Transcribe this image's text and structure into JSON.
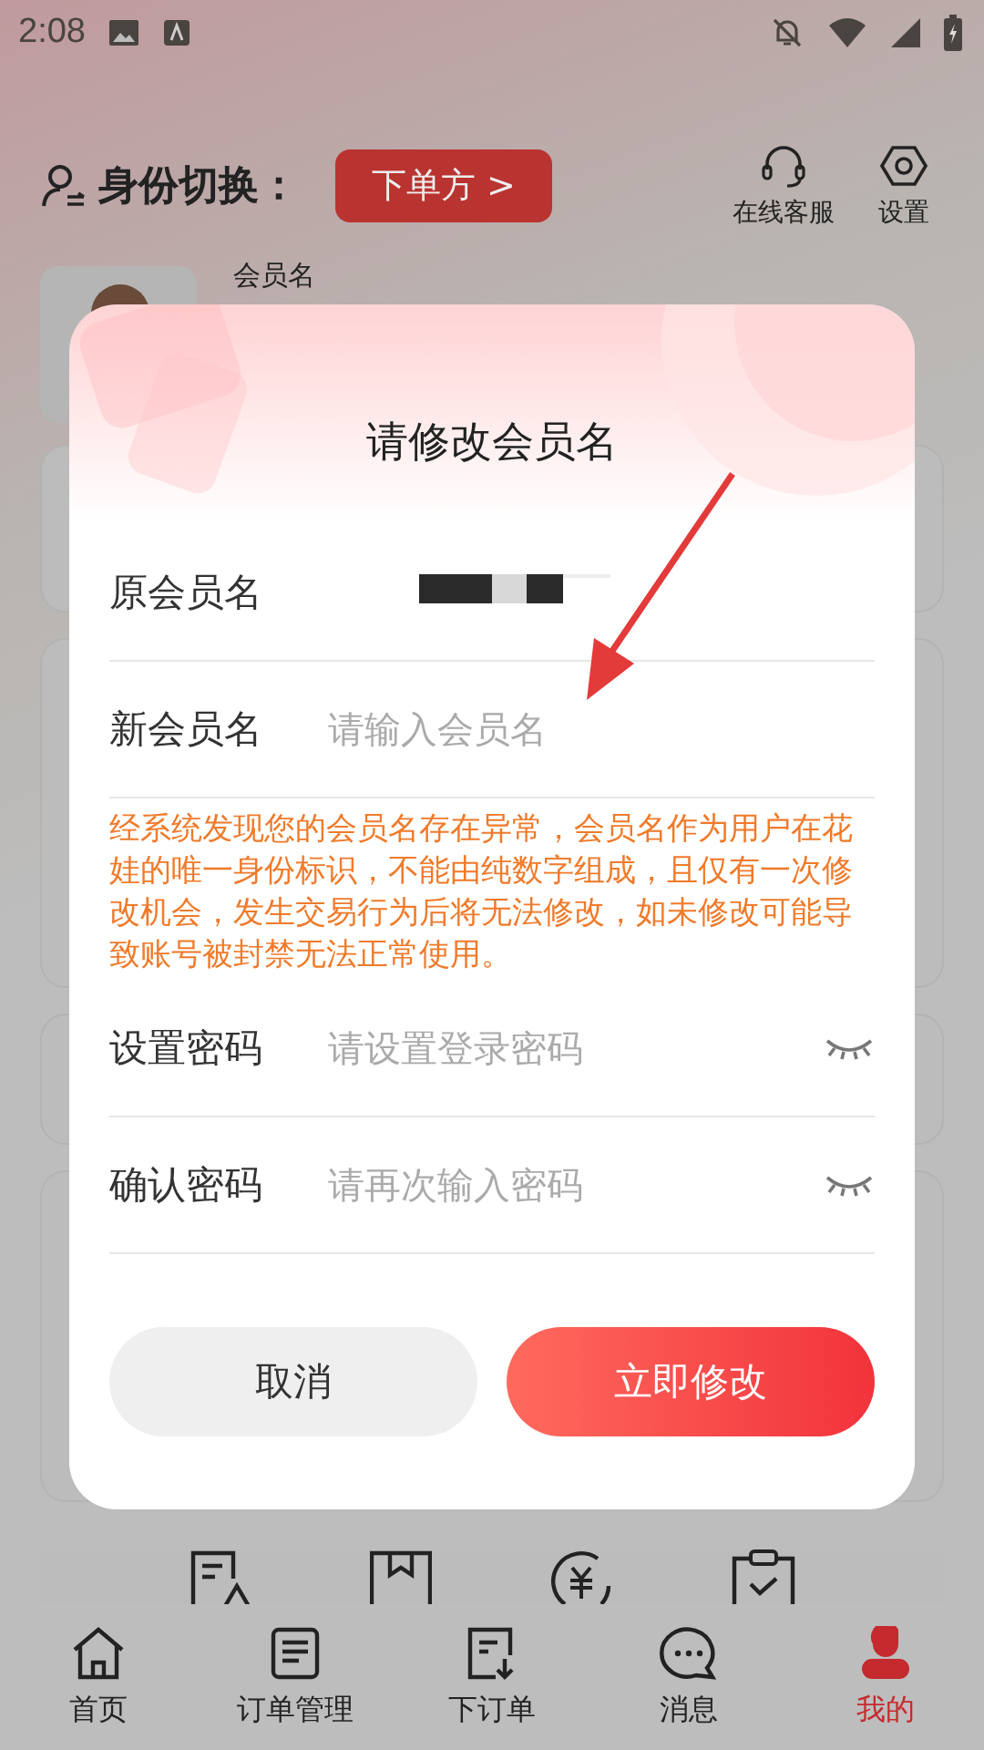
{
  "status_bar": {
    "time": "2:08"
  },
  "header": {
    "switch_label": "身份切换：",
    "role_button": "下单方 >",
    "actions": [
      {
        "kind": "headset",
        "label": "在线客服"
      },
      {
        "kind": "settings",
        "label": "设置"
      }
    ]
  },
  "profile": {
    "member_label": "会员名"
  },
  "shortcuts": [
    {
      "kind": "doc-warning"
    },
    {
      "kind": "box"
    },
    {
      "kind": "refund"
    },
    {
      "kind": "clipboard"
    }
  ],
  "tab_bar": [
    {
      "kind": "home",
      "label": "首页",
      "selected": false
    },
    {
      "kind": "list",
      "label": "订单管理",
      "selected": false
    },
    {
      "kind": "order",
      "label": "下订单",
      "selected": false
    },
    {
      "kind": "chat",
      "label": "消息",
      "selected": false
    },
    {
      "kind": "me",
      "label": "我的",
      "selected": true
    }
  ],
  "dialog": {
    "title": "请修改会员名",
    "fields": [
      {
        "kind": "readonly",
        "label": "原会员名"
      },
      {
        "kind": "text",
        "label": "新会员名",
        "placeholder": "请输入会员名"
      },
      {
        "kind": "password",
        "label": "设置密码",
        "placeholder": "请设置登录密码"
      },
      {
        "kind": "password",
        "label": "确认密码",
        "placeholder": "请再次输入密码"
      }
    ],
    "notice": "经系统发现您的会员名存在异常，会员名作为用户在花娃的唯一身份标识，不能由纯数字组成，且仅有一次修改机会，发生交易行为后将无法修改，如未修改可能导致账号被封禁无法正常使用。",
    "buttons": [
      {
        "kind": "secondary",
        "label": "取消"
      },
      {
        "kind": "primary",
        "label": "立即修改"
      }
    ]
  }
}
